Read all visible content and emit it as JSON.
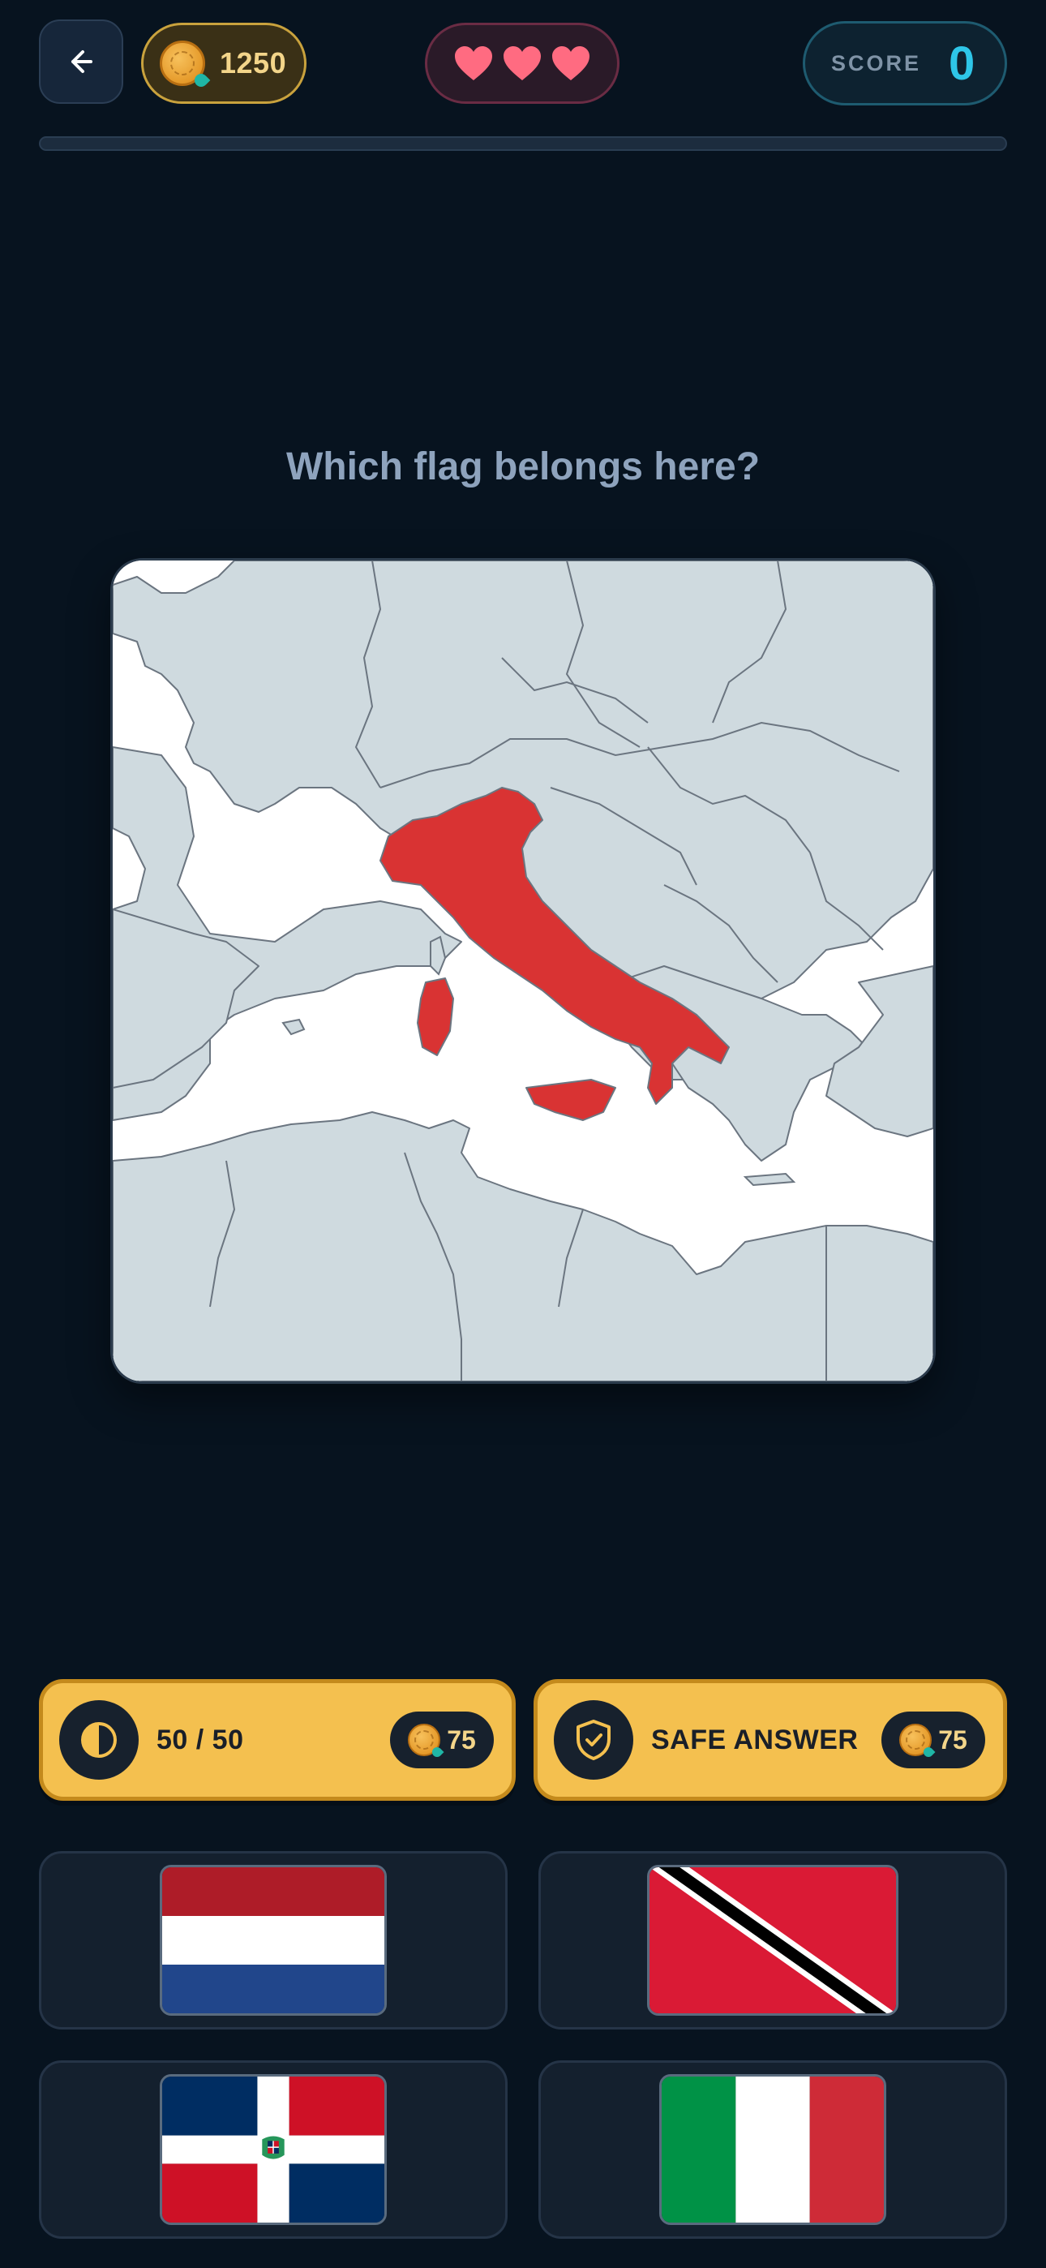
{
  "header": {
    "back_icon": "arrow-left-icon",
    "coins": "1250",
    "coin_icon": "coin-icon",
    "lives": [
      {
        "icon": "heart-icon",
        "color": "#ff6b81"
      },
      {
        "icon": "heart-icon",
        "color": "#ff6b81"
      },
      {
        "icon": "heart-icon",
        "color": "#ff6b81"
      }
    ],
    "score_label": "SCORE",
    "score_value": "0"
  },
  "progress": {
    "fraction": 0.0,
    "color": "#2ec6e8"
  },
  "question": "Which flag belongs here?",
  "map": {
    "highlighted_country": "Italy",
    "highlight_color": "#d93333",
    "land_color": "#cfdadf",
    "sea_color": "#ffffff"
  },
  "powerups": [
    {
      "id": "fifty-fifty",
      "label": "50 / 50",
      "icon": "half-circle-icon",
      "cost": "75"
    },
    {
      "id": "safe-answer",
      "label": "SAFE ANSWER",
      "icon": "shield-check-icon",
      "cost": "75"
    }
  ],
  "answers": [
    {
      "flag": "Netherlands",
      "colors": [
        "#ae1c28",
        "#ffffff",
        "#21468b"
      ]
    },
    {
      "flag": "Trinidad and Tobago",
      "colors": [
        "#da1a35",
        "#000000",
        "#ffffff"
      ]
    },
    {
      "flag": "Dominican Republic",
      "colors": [
        "#002d62",
        "#ce1126",
        "#ffffff"
      ]
    },
    {
      "flag": "Italy",
      "colors": [
        "#009246",
        "#ffffff",
        "#ce2b37"
      ]
    }
  ],
  "theme": {
    "background": "#07131f",
    "accent": "#2ec6e8",
    "gold": "#f4c04f"
  }
}
